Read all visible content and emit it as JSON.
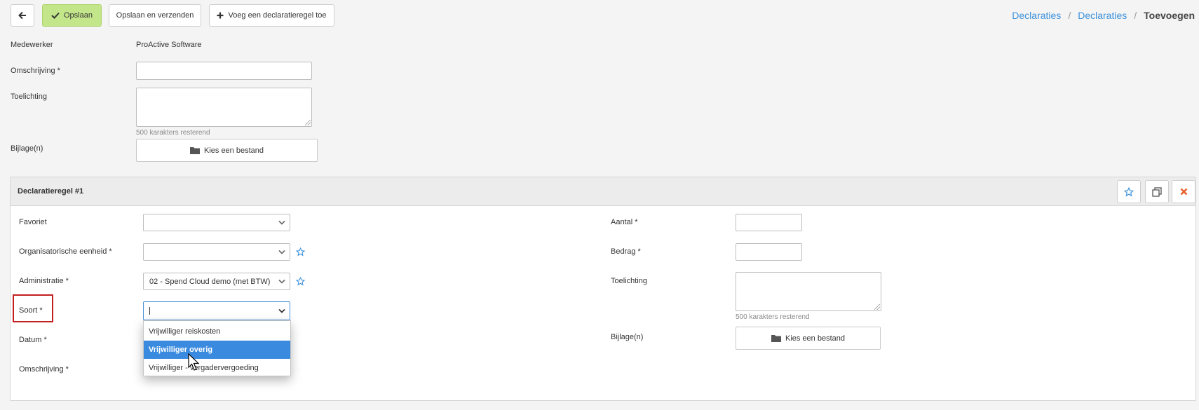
{
  "toolbar": {
    "save_label": "Opslaan",
    "save_send_label": "Opslaan en verzenden",
    "add_line_label": "Voeg een declaratieregel toe",
    "save_color": "#c4e68a"
  },
  "breadcrumb": {
    "items": [
      "Declaraties",
      "Declaraties",
      "Toevoegen"
    ],
    "separator": "/",
    "link_color": "#3c91db"
  },
  "form": {
    "employee_label": "Medewerker",
    "employee_value": "ProActive Software",
    "description_label": "Omschrijving *",
    "description_value": "",
    "note_label": "Toelichting",
    "note_value": "",
    "chars_remaining": "500 karakters resterend",
    "attachments_label": "Bijlage(n)",
    "choose_file_label": "Kies een bestand"
  },
  "line": {
    "title": "Declaratieregel #1",
    "left": {
      "favorite_label": "Favoriet",
      "favorite_value": "",
      "org_unit_label": "Organisatorische eenheid *",
      "org_unit_value": "",
      "administration_label": "Administratie *",
      "administration_value": "02 - Spend Cloud demo (met BTW)",
      "type_label": "Soort *",
      "type_value": "",
      "date_label": "Datum *",
      "description_label": "Omschrijving *"
    },
    "right": {
      "amount_count_label": "Aantal *",
      "amount_count_value": "",
      "amount_label": "Bedrag *",
      "amount_value": "",
      "note_label": "Toelichting",
      "note_value": "",
      "chars_remaining": "500 karakters resterend",
      "attachments_label": "Bijlage(n)",
      "choose_file_label": "Kies een bestand"
    },
    "type_dropdown": {
      "options": [
        "Vrijwilliger reiskosten",
        "Vrijwilliger overig",
        "Vrijwilliger - vergadervergoeding"
      ],
      "highlighted_index": 1,
      "highlight_color": "#3a8be0"
    },
    "header_icons": [
      "star-icon",
      "copy-icon",
      "close-icon"
    ]
  }
}
